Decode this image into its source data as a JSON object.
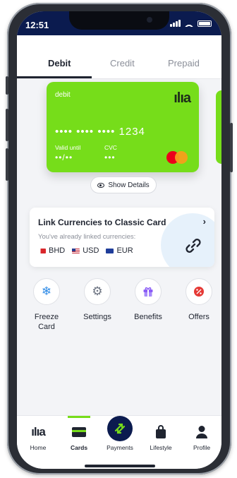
{
  "status": {
    "time": "12:51"
  },
  "tabs": [
    "Debit",
    "Credit",
    "Prepaid"
  ],
  "card": {
    "label": "debit",
    "logo": "ılıa",
    "number": "•••• •••• •••• 1234",
    "valid_label": "Valid until",
    "valid_value": "••/••",
    "cvc_label": "CVC",
    "cvc_value": "•••",
    "color": "#76dd1a"
  },
  "show_details": "Show Details",
  "link_panel": {
    "title": "Link Currencies to Classic Card",
    "subtitle": "You've already linked currencies:",
    "currencies": [
      "BHD",
      "USD",
      "EUR"
    ]
  },
  "actions": [
    {
      "label": "Freeze Card",
      "icon": "snowflake-icon",
      "color": "#2e8ae6"
    },
    {
      "label": "Settings",
      "icon": "gear-icon",
      "color": "#6b7280"
    },
    {
      "label": "Benefits",
      "icon": "gift-icon",
      "color": "#8b5cf6"
    },
    {
      "label": "Offers",
      "icon": "percent-badge-icon",
      "color": "#e53935"
    }
  ],
  "nav": [
    {
      "label": "Home",
      "icon": "ila-logo-icon"
    },
    {
      "label": "Cards",
      "icon": "card-icon",
      "active": true
    },
    {
      "label": "Payments",
      "icon": "transfer-arrows-icon"
    },
    {
      "label": "Lifestyle",
      "icon": "shopping-bag-icon"
    },
    {
      "label": "Profile",
      "icon": "person-icon"
    }
  ],
  "colors": {
    "header": "#0b1b4f",
    "accent": "#76dd1a"
  }
}
